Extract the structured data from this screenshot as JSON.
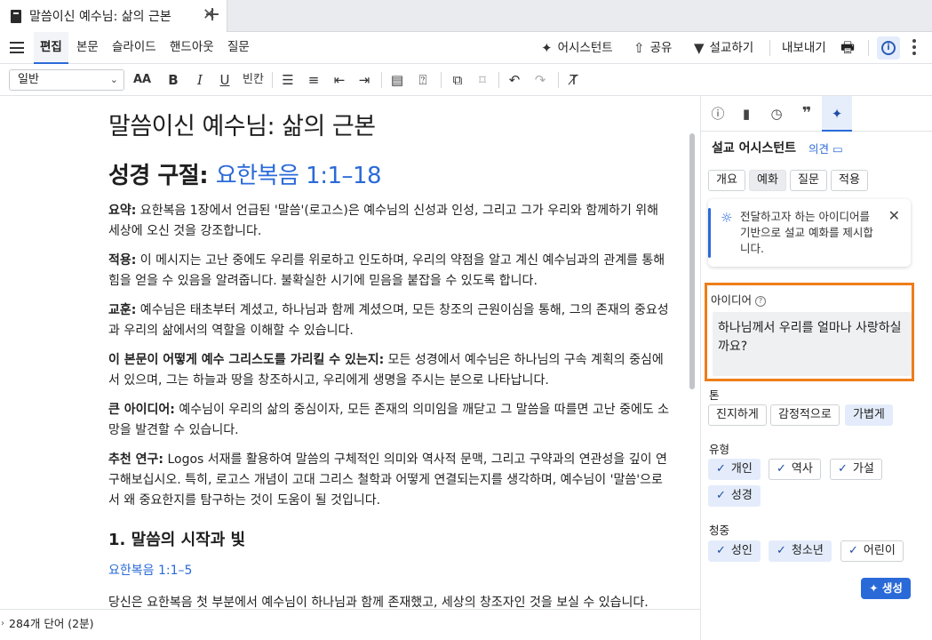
{
  "tabs": {
    "title": "말씀이신 예수님: 삶의 근본",
    "close": "✕",
    "new": "+"
  },
  "menubar": {
    "items": [
      "편집",
      "본문",
      "슬라이드",
      "핸드아웃",
      "질문"
    ],
    "assistant": "어시스턴트",
    "share": "공유",
    "preach": "설교하기",
    "export": "내보내기"
  },
  "toolbar": {
    "style": "일반",
    "font_size": "AA",
    "bold": "B",
    "italic": "I",
    "underline": "U",
    "blank": "빈칸"
  },
  "document": {
    "title": "말씀이신 예수님: 삶의 근본",
    "scripture_label": "성경 구절:",
    "scripture_ref": "요한복음 1:1–18",
    "sections": [
      {
        "label": "요약:",
        "text": " 요한복음 1장에서 언급된 '말씀'(로고스)은 예수님의 신성과 인성, 그리고 그가 우리와 함께하기 위해 세상에 오신 것을 강조합니다."
      },
      {
        "label": "적용:",
        "text": " 이 메시지는 고난 중에도 우리를 위로하고 인도하며, 우리의 약점을 알고 계신 예수님과의 관계를 통해 힘을 얻을 수 있음을 알려줍니다. 불확실한 시기에 믿음을 붙잡을 수 있도록 합니다."
      },
      {
        "label": "교훈:",
        "text": " 예수님은 태초부터 계셨고, 하나님과 함께 계셨으며, 모든 창조의 근원이심을 통해, 그의 존재의 중요성과 우리의 삶에서의 역할을 이해할 수 있습니다."
      },
      {
        "label": "이 본문이 어떻게 예수 그리스도를 가리킬 수 있는지:",
        "text": " 모든 성경에서 예수님은 하나님의 구속 계획의 중심에 서 있으며, 그는 하늘과 땅을 창조하시고, 우리에게 생명을 주시는 분으로 나타납니다."
      },
      {
        "label": "큰 아이디어:",
        "text": " 예수님이 우리의 삶의 중심이자, 모든 존재의 의미임을 깨닫고 그 말씀을 따를면 고난 중에도 소망을 발견할 수 있습니다."
      },
      {
        "label": "추천 연구:",
        "text": " Logos 서재를 활용하여 말씀의 구체적인 의미와 역사적 문맥, 그리고 구약과의 연관성을 깊이 연구해보십시오. 특히, 로고스 개념이 고대 그리스 철학과 어떻게 연결되는지를 생각하며, 예수님이 '말씀'으로서 왜 중요한지를 탐구하는 것이 도움이 될 것입니다."
      }
    ],
    "heading1": "1. 말씀의 시작과 빛",
    "heading1_ref": "요한복음 1:1–5",
    "last_para": "당신은 요한복음 첫 부분에서 예수님이 하나님과 함께 존재했고, 세상의 창조자인 것을 보실 수 있습니다."
  },
  "status": {
    "word_count": "284개 단어 (2분)"
  },
  "panel": {
    "title": "설교 어시스턴트",
    "feedback": "의견",
    "subtabs": [
      "개요",
      "예화",
      "질문",
      "적용"
    ],
    "tip": "전달하고자 하는 아이디어를 기반으로 설교 예화를 제시합니다.",
    "idea_label": "아이디어",
    "idea_value": "하나님께서 우리를 얼마나 사랑하실까요?",
    "tone_label": "톤",
    "tones": [
      "진지하게",
      "감정적으로",
      "가볍게"
    ],
    "type_label": "유형",
    "types": [
      "개인",
      "역사",
      "가설",
      "성경"
    ],
    "audience_label": "청중",
    "audiences": [
      "성인",
      "청소년",
      "어린이"
    ],
    "generate": "생성"
  },
  "colors": {
    "accent": "#2a6ad8",
    "highlight": "#ef7d18"
  }
}
